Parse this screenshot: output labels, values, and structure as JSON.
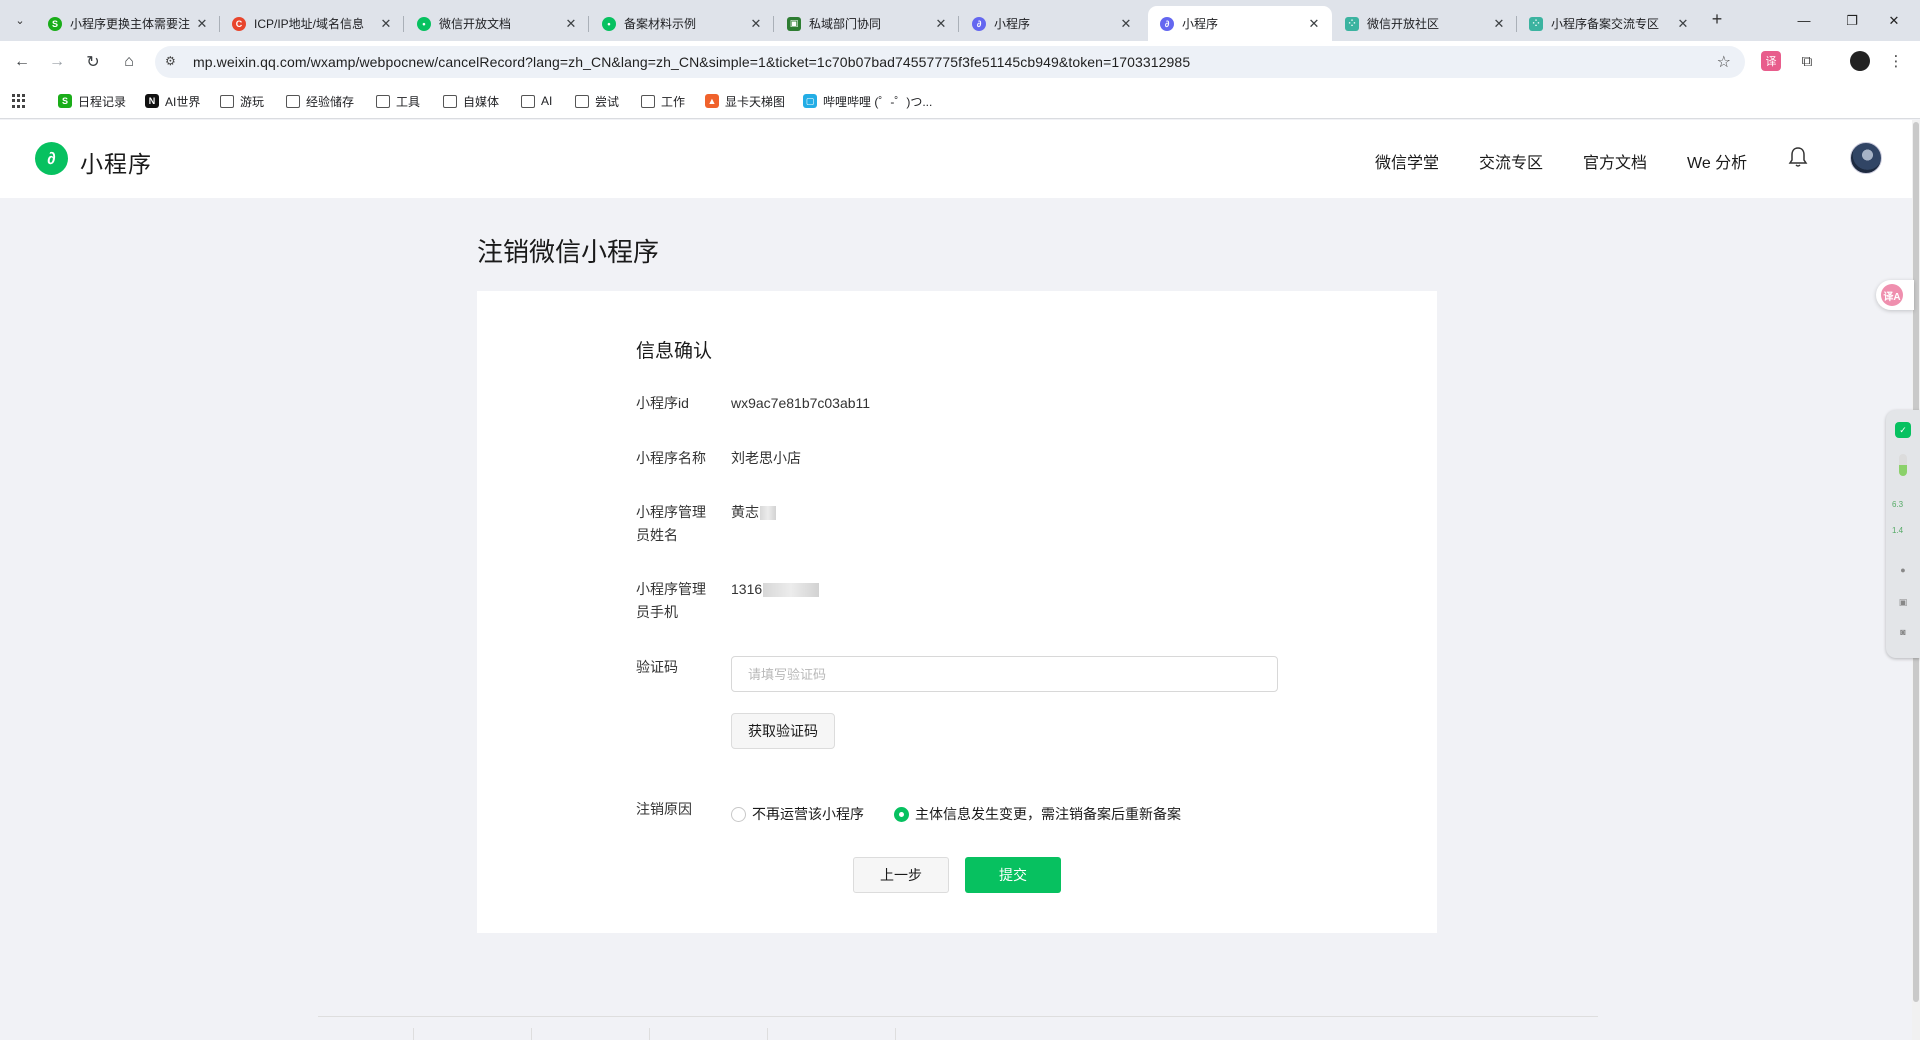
{
  "browser": {
    "tabs": [
      {
        "title": "小程序更换主体需要注",
        "fav_color": "#1aad19",
        "fav_glyph": "S"
      },
      {
        "title": "ICP/IP地址/域名信息",
        "fav_color": "#e8452c",
        "fav_glyph": "C"
      },
      {
        "title": "微信开放文档",
        "fav_color": "#07c160",
        "fav_glyph": "•"
      },
      {
        "title": "备案材料示例",
        "fav_color": "#07c160",
        "fav_glyph": "•"
      },
      {
        "title": "私域部门协同",
        "fav_color": "#2e7d32",
        "fav_glyph": "▣"
      },
      {
        "title": "小程序",
        "fav_color": "#6467f0",
        "fav_glyph": "∂"
      },
      {
        "title": "小程序",
        "fav_color": "#6467f0",
        "fav_glyph": "∂",
        "active": true
      },
      {
        "title": "微信开放社区",
        "fav_color": "#3bb3a0",
        "fav_glyph": "⁘"
      },
      {
        "title": "小程序备案交流专区",
        "fav_color": "#3bb3a0",
        "fav_glyph": "⁘"
      }
    ],
    "new_tab_glyph": "+",
    "window_controls": {
      "minimize": "—",
      "restore": "❐",
      "close": "✕"
    },
    "url": "mp.weixin.qq.com/wxamp/webpocnew/cancelRecord?lang=zh_CN&lang=zh_CN&simple=1&ticket=1c70b07bad74557775f3fe51145cb949&token=1703312985",
    "bookmarks": [
      {
        "label": "日程记录",
        "type": "fav",
        "color": "#1aad19",
        "glyph": "S"
      },
      {
        "label": "AI世界",
        "type": "fav",
        "color": "#111111",
        "glyph": "N"
      },
      {
        "label": "游玩",
        "type": "folder"
      },
      {
        "label": "经验储存",
        "type": "folder"
      },
      {
        "label": "工具",
        "type": "folder"
      },
      {
        "label": "自媒体",
        "type": "folder"
      },
      {
        "label": "AI",
        "type": "folder"
      },
      {
        "label": "尝试",
        "type": "folder"
      },
      {
        "label": "工作",
        "type": "folder"
      },
      {
        "label": "显卡天梯图",
        "type": "fav",
        "color": "#f0622c",
        "glyph": "▲"
      },
      {
        "label": "哔哩哔哩 (゜-゜)つ...",
        "type": "fav",
        "color": "#23ade5",
        "glyph": "▢"
      }
    ]
  },
  "site": {
    "logo_text": "小程序",
    "nav": [
      "微信学堂",
      "交流专区",
      "官方文档",
      "We 分析"
    ]
  },
  "page": {
    "title": "注销微信小程序",
    "section_title": "信息确认",
    "fields": {
      "appid_label": "小程序id",
      "appid_value": "wx9ac7e81b7c03ab11",
      "name_label": "小程序名称",
      "name_value": "刘老思小店",
      "admin_name_label": "小程序管理员姓名",
      "admin_name_value": "黄志",
      "admin_phone_label": "小程序管理员手机",
      "admin_phone_value": "1316",
      "code_label": "验证码",
      "code_placeholder": "请填写验证码",
      "code_value": ""
    },
    "get_code_button": "获取验证码",
    "reason_label": "注销原因",
    "reasons": [
      {
        "label": "不再运营该小程序",
        "checked": false
      },
      {
        "label": "主体信息发生变更，需注销备案后重新备案",
        "checked": true
      }
    ],
    "prev_button": "上一步",
    "submit_button": "提交"
  },
  "side_widget": {
    "speed_up": "6.3",
    "speed_down": "1.4",
    "translate_glyph": "译A"
  },
  "colors": {
    "brand_green": "#07c160",
    "page_bg": "#f1f2f6",
    "card_bg": "#ffffff"
  }
}
